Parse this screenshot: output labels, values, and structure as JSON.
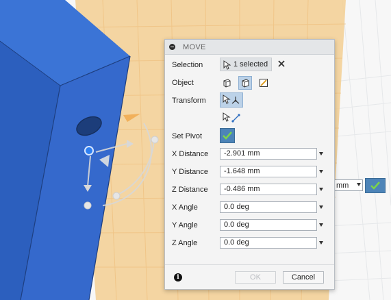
{
  "dialog": {
    "title": "MOVE",
    "rows": {
      "selection": {
        "label": "Selection",
        "chip": "1 selected"
      },
      "object": {
        "label": "Object"
      },
      "transform": {
        "label": "Transform"
      },
      "set_pivot": {
        "label": "Set Pivot"
      },
      "x_distance": {
        "label": "X Distance",
        "value": "-2.901 mm"
      },
      "y_distance": {
        "label": "Y Distance",
        "value": "-1.648 mm"
      },
      "z_distance": {
        "label": "Z Distance",
        "value": "-0.486 mm"
      },
      "x_angle": {
        "label": "X Angle",
        "value": "0.0 deg"
      },
      "y_angle": {
        "label": "Y Angle",
        "value": "0.0 deg"
      },
      "z_angle": {
        "label": "Z Angle",
        "value": "0.0 deg"
      }
    },
    "footer": {
      "ok_label": "OK",
      "cancel_label": "Cancel"
    }
  },
  "canvas_inline": {
    "unit": "mm"
  },
  "colors": {
    "body_blue": "#2f66c9",
    "sketch_plane": "#f3cf93",
    "accent_blue": "#4d84b8",
    "check_green": "#7bd34a"
  },
  "icons": [
    "cursor-icon",
    "close-icon",
    "body-icon",
    "component-icon",
    "sketch-object-icon",
    "free-move-icon",
    "point-to-point-icon",
    "checkmark-icon",
    "info-icon",
    "collapse-icon"
  ]
}
